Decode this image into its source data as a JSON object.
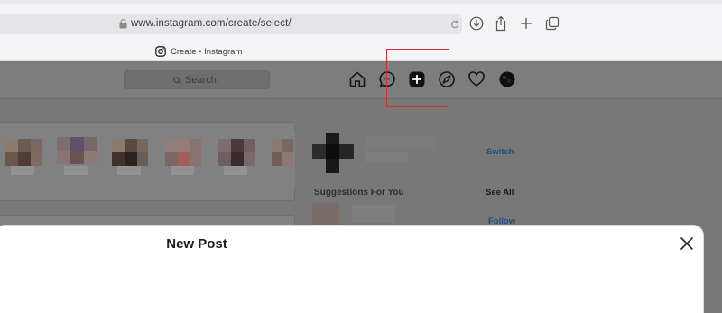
{
  "browser": {
    "url": "www.instagram.com/create/select/",
    "tab_title": "Create • Instagram",
    "buttons": [
      "download-icon",
      "share-icon",
      "new-tab-icon",
      "tabs-overview-icon"
    ]
  },
  "instagram": {
    "search_placeholder": "Search",
    "nav_icons": [
      "home-icon",
      "messenger-icon",
      "new-post-icon",
      "explore-icon",
      "activity-heart-icon",
      "profile-avatar"
    ],
    "sidebar": {
      "switch_label": "Switch",
      "suggestions_label": "Suggestions For You",
      "see_all_label": "See All",
      "follow_label": "Follow"
    }
  },
  "modal": {
    "title": "New Post",
    "close_icon": "close-icon"
  },
  "colors": {
    "highlight": "#d23131",
    "link": "#1f4e7a"
  }
}
